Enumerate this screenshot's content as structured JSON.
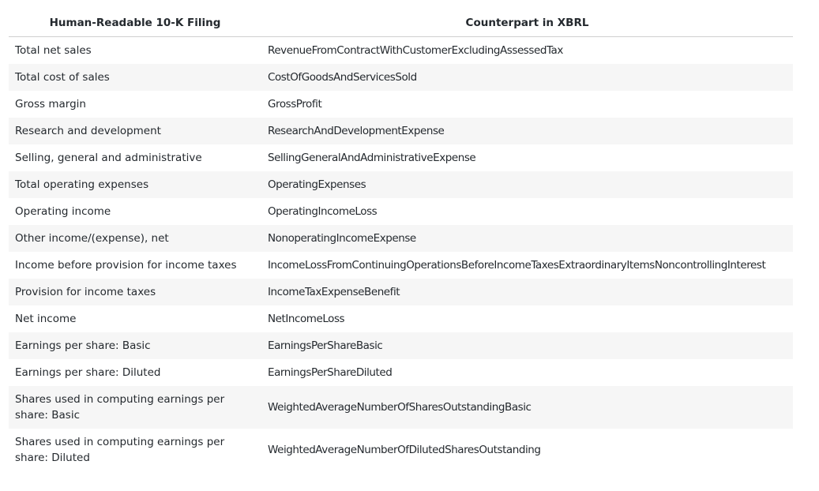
{
  "table": {
    "headers": [
      "Human-Readable 10-K Filing",
      "Counterpart in XBRL"
    ],
    "rows": [
      [
        "Total net sales",
        "RevenueFromContractWithCustomerExcludingAssessedTax"
      ],
      [
        "Total cost of sales",
        "CostOfGoodsAndServicesSold"
      ],
      [
        "Gross margin",
        "GrossProfit"
      ],
      [
        "Research and development",
        "ResearchAndDevelopmentExpense"
      ],
      [
        "Selling, general and administrative",
        "SellingGeneralAndAdministrativeExpense"
      ],
      [
        "Total operating expenses",
        "OperatingExpenses"
      ],
      [
        "Operating income",
        "OperatingIncomeLoss"
      ],
      [
        "Other income/(expense), net",
        "NonoperatingIncomeExpense"
      ],
      [
        "Income before provision for income taxes",
        "IncomeLossFromContinuingOperationsBeforeIncomeTaxesExtraordinaryItemsNoncontrollingInterest"
      ],
      [
        "Provision for income taxes",
        "IncomeTaxExpenseBenefit"
      ],
      [
        "Net income",
        "NetIncomeLoss"
      ],
      [
        "Earnings per share: Basic",
        "EarningsPerShareBasic"
      ],
      [
        "Earnings per share: Diluted",
        "EarningsPerShareDiluted"
      ],
      [
        "Shares used in computing earnings per share: Basic",
        "WeightedAverageNumberOfSharesOutstandingBasic"
      ],
      [
        "Shares used in computing earnings per share: Diluted",
        "WeightedAverageNumberOfDilutedSharesOutstanding"
      ]
    ]
  }
}
